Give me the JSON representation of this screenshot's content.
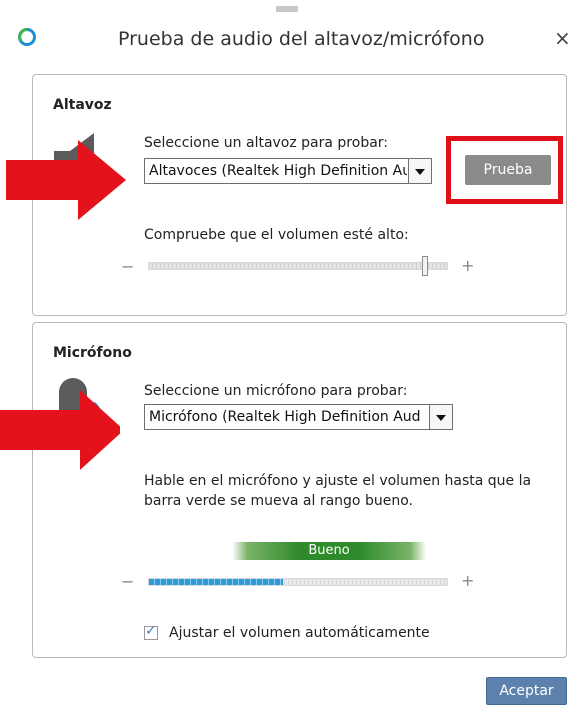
{
  "window": {
    "title": "Prueba de audio del altavoz/micrófono",
    "close_label": "×"
  },
  "speaker": {
    "title": "Altavoz",
    "select_prompt": "Seleccione un altavoz para probar:",
    "selected_device": "Altavoces (Realtek High Definition Aud",
    "test_label": "Prueba",
    "volume_prompt": "Compruebe que el volumen esté alto:",
    "minus": "−",
    "plus": "+",
    "volume_level": 0.92
  },
  "microphone": {
    "title": "Micrófono",
    "select_prompt": "Seleccione un micrófono para probar:",
    "selected_device": "Micrófono (Realtek High Definition Aud",
    "instructions": "Hable en el micrófono y ajuste el volumen hasta que la barra verde se mueva al rango bueno.",
    "good_label": "Bueno",
    "minus": "−",
    "plus": "+",
    "input_level": 0.45,
    "auto_adjust_label": "Ajustar el volumen automáticamente",
    "auto_adjust_checked": true
  },
  "footer": {
    "accept_label": "Aceptar"
  },
  "colors": {
    "highlight": "#e0101a",
    "accent": "#5d81ad",
    "good": "#2e8a2a"
  }
}
